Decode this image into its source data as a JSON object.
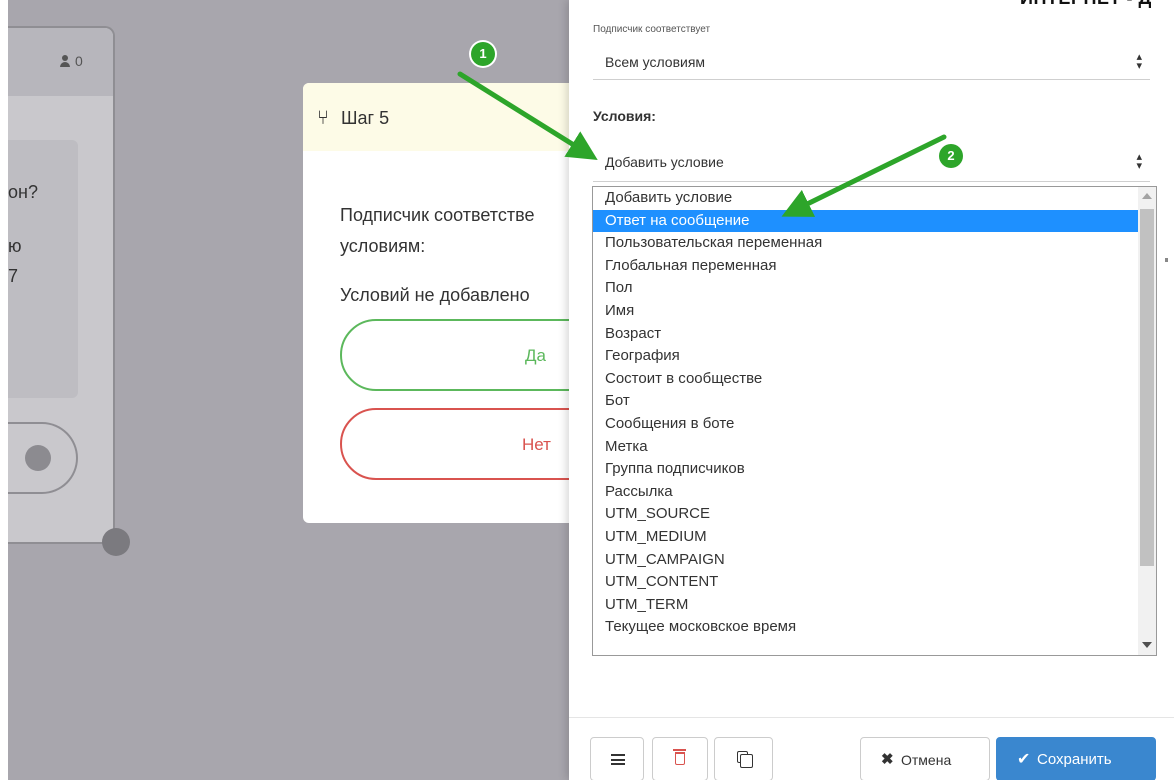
{
  "background_card": {
    "count": "0",
    "text_lines": [
      "он?",
      "ю",
      "7"
    ]
  },
  "step_card": {
    "title": "Шаг 5",
    "question": "Подписчик соответствует условиям:",
    "question_line1": "Подписчик соответстве",
    "question_line2": "условиям:",
    "no_conditions": "Условий не добавлено",
    "yes_label": "Да",
    "no_label": "Нет"
  },
  "panel": {
    "top_right_text": "ИНТЕРНЕТ - Д",
    "match_label": "Подписчик соответствует",
    "match_value": "Всем условиям",
    "conditions_label": "Условия:",
    "add_condition_value": "Добавить условие",
    "dropdown_options": [
      "Добавить условие",
      "Ответ на сообщение",
      "Пользовательская переменная",
      "Глобальная переменная",
      "Пол",
      "Имя",
      "Возраст",
      "География",
      "Состоит в сообществе",
      "Бот",
      "Сообщения в боте",
      "Метка",
      "Группа подписчиков",
      "Рассылка",
      "UTM_SOURCE",
      "UTM_MEDIUM",
      "UTM_CAMPAIGN",
      "UTM_CONTENT",
      "UTM_TERM",
      "Текущее московское время"
    ],
    "selected_option": "Ответ на сообщение",
    "cancel_label": "Отмена",
    "save_label": "Сохранить"
  },
  "annotations": {
    "marker1": "1",
    "marker2": "2"
  },
  "colors": {
    "overlay": "#a8a6ad",
    "step_header": "#fdfbe7",
    "yes": "#5cb85c",
    "no": "#d9534f",
    "selected": "#1e90ff",
    "save": "#3a87cf",
    "annotation": "#2da52a"
  },
  "icons": {
    "users": "user-icon",
    "branch": "branch-icon",
    "menu": "hamburger-icon",
    "delete": "trash-icon",
    "copy": "copy-icon",
    "cancel": "times-icon",
    "save": "check-icon",
    "select": "sort-caret-icon"
  }
}
